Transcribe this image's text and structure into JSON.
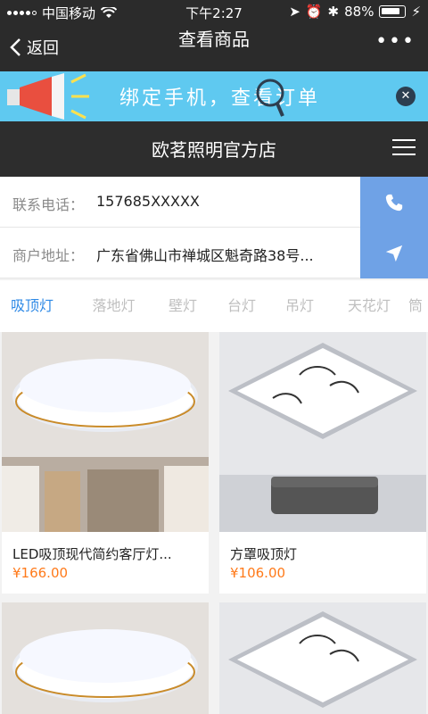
{
  "status": {
    "carrier": "中国移动",
    "time": "下午2:27",
    "battery": "88%"
  },
  "nav": {
    "back_label": "返回",
    "title": "查看商品",
    "more_label": "•••"
  },
  "banner": {
    "text": "绑定手机，查看订单"
  },
  "shop": {
    "name": "欧茗照明官方店"
  },
  "contact": {
    "phone_label": "联系电话：",
    "phone_value": "157685XXXXX",
    "address_label": "商户地址：",
    "address_value": "广东省佛山市禅城区魁奇路38号..."
  },
  "tabs": [
    "吸顶灯",
    "落地灯",
    "壁灯",
    "台灯",
    "吊灯",
    "天花灯",
    "筒"
  ],
  "products": [
    {
      "title": "LED吸顶现代简约客厅灯...",
      "price": "¥166.00"
    },
    {
      "title": "方罩吸顶灯",
      "price": "¥106.00"
    }
  ],
  "colors": {
    "accent": "#2f8ae6",
    "price": "#ff7a1a",
    "action": "#6fa2e6",
    "banner": "#5fc9f0"
  }
}
